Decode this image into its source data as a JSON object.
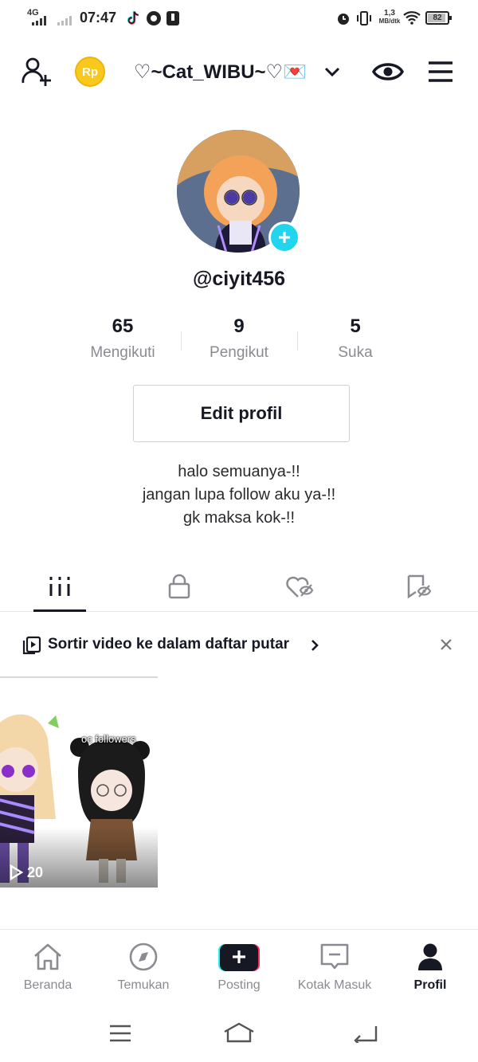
{
  "status_bar": {
    "network": "4G",
    "time": "07:47",
    "speed_value": "1,3",
    "speed_unit": "MB/dtk",
    "battery": "82"
  },
  "header": {
    "title": "♡~Cat_WIBU~♡💌",
    "coin_label": "Rp"
  },
  "profile": {
    "handle": "@ciyit456",
    "stats": [
      {
        "value": "65",
        "label": "Mengikuti"
      },
      {
        "value": "9",
        "label": "Pengikut"
      },
      {
        "value": "5",
        "label": "Suka"
      }
    ],
    "edit_button": "Edit profil",
    "bio_lines": [
      "halo semuanya-!!",
      "jangan lupa follow aku ya-!!",
      "gk maksa kok-!!"
    ]
  },
  "tabs": [
    "videos-grid-icon",
    "lock-icon",
    "liked-hidden-icon",
    "bookmark-hidden-icon"
  ],
  "playlist_prompt": {
    "text": "Sortir video ke dalam daftar putar"
  },
  "videos": [
    {
      "overlay_text": "oc followers",
      "views": "20"
    }
  ],
  "bottom_nav": [
    {
      "label": "Beranda",
      "icon": "home-icon"
    },
    {
      "label": "Temukan",
      "icon": "compass-icon"
    },
    {
      "label": "Posting",
      "icon": "plus-icon"
    },
    {
      "label": "Kotak Masuk",
      "icon": "inbox-icon"
    },
    {
      "label": "Profil",
      "icon": "profile-icon",
      "active": true
    }
  ],
  "colors": {
    "accent_cyan": "#20d5ec",
    "accent_red": "#fe2c55",
    "text_dark": "#161823",
    "text_gray": "#8a8b91"
  }
}
